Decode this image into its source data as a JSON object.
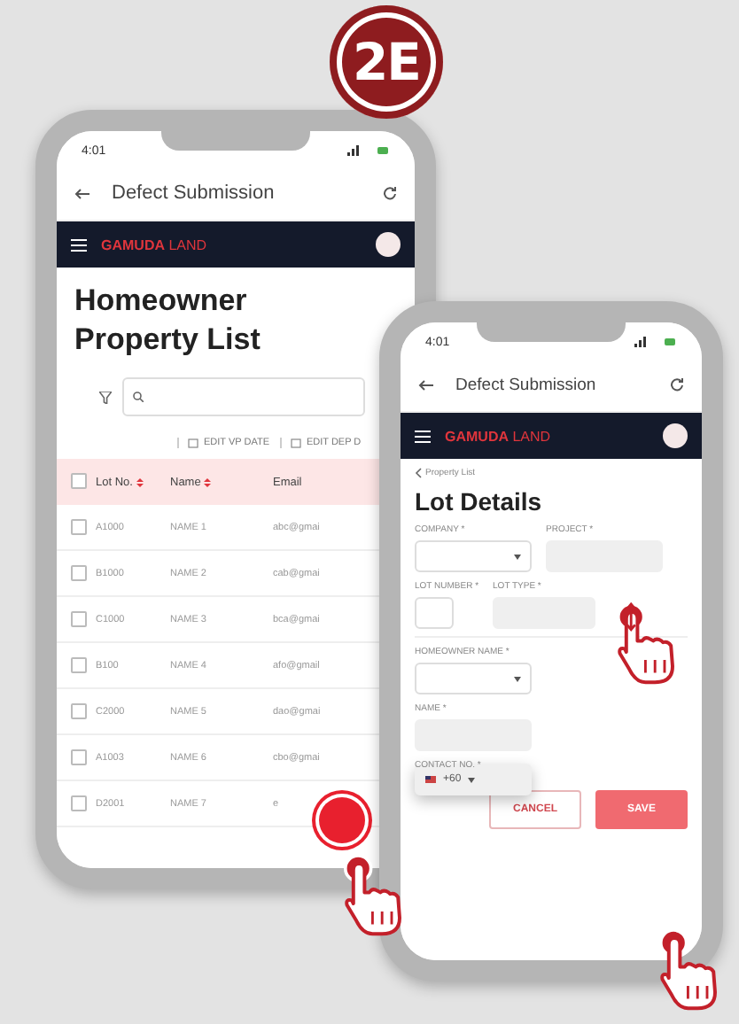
{
  "badge": {
    "label": "2E"
  },
  "list_phone": {
    "status_bar": {
      "time": "4:01"
    },
    "app_bar": {
      "title": "Defect Submission"
    },
    "nav": {
      "logo_bold": "GAMUDA",
      "logo_light": "LAND"
    },
    "page_title": "Homeowner Property List",
    "toolbar": [
      "EDIT VP DATE",
      "EDIT DEP D"
    ],
    "table": {
      "select_all": {
        "checked": false
      },
      "columns": [
        {
          "label": "Lot No.",
          "sortable": true
        },
        {
          "label": "Name",
          "sortable": true
        },
        {
          "label": "Email",
          "sortable": false
        }
      ],
      "rows": [
        {
          "checked": false,
          "cells": [
            "A1000",
            "NAME 1",
            "abc@gmai"
          ]
        },
        {
          "checked": false,
          "cells": [
            "B1000",
            "NAME 2",
            "cab@gmai"
          ]
        },
        {
          "checked": false,
          "cells": [
            "C1000",
            "NAME 3",
            "bca@gmai"
          ]
        },
        {
          "checked": false,
          "cells": [
            "B100",
            "NAME 4",
            "afo@gmail"
          ]
        },
        {
          "checked": false,
          "cells": [
            "C2000",
            "NAME 5",
            "dao@gmai"
          ]
        },
        {
          "checked": false,
          "cells": [
            "A1003",
            "NAME 6",
            "cbo@gmai"
          ]
        },
        {
          "checked": false,
          "cells": [
            "D2001",
            "NAME 7",
            "e"
          ]
        }
      ]
    }
  },
  "detail_phone": {
    "status_bar": {
      "time": "4:01"
    },
    "app_bar": {
      "title": "Defect Submission"
    },
    "nav": {
      "logo_bold": "GAMUDA",
      "logo_light": "LAND"
    },
    "breadcrumb": "Property List",
    "page_title": "Lot Details",
    "form_rows": [
      [
        {
          "label": "COMPANY *",
          "kind": "select",
          "disabled": false
        },
        {
          "label": "PROJECT *",
          "kind": "text",
          "disabled": true
        }
      ],
      [
        {
          "label": "LOT NUMBER *",
          "kind": "text",
          "disabled": false
        },
        {
          "label": "LOT TYPE *",
          "kind": "text",
          "disabled": true
        }
      ],
      [
        {
          "label": "HOMEOWNER NAME *",
          "kind": "select",
          "disabled": false
        }
      ],
      [
        {
          "label": "NAME *",
          "kind": "text",
          "disabled": true
        }
      ],
      [
        {
          "label": "CONTACT NO. *",
          "kind": "phone",
          "disabled": true,
          "value": "+60"
        }
      ]
    ],
    "buttons": [
      {
        "label": "CANCEL",
        "kind": "outline"
      },
      {
        "label": "SAVE",
        "kind": "primary"
      }
    ]
  }
}
